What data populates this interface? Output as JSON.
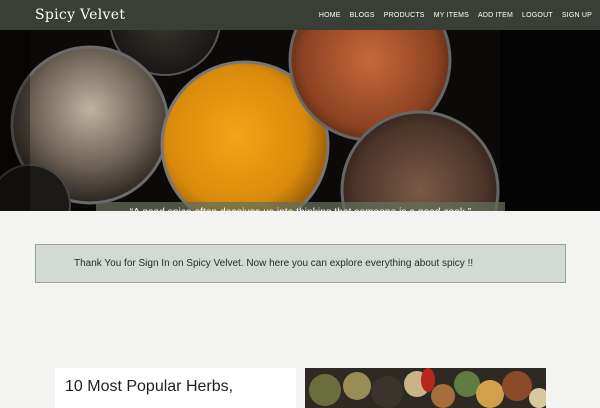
{
  "navbar": {
    "brand": "Spicy Velvet",
    "links": [
      "HOME",
      "BLOGS",
      "PRODUCTS",
      "MY ITEMS",
      "ADD ITEM",
      "LOGOUT",
      "SIGN UP"
    ]
  },
  "hero": {
    "quote": "“A good spice often deceives us into thinking that someone is a good cook.”",
    "slide_count": 6,
    "active_slide": 4
  },
  "alert": {
    "message": "Thank You for Sign In on Spicy Velvet. Now here you can explore everything about spicy !!"
  },
  "blog": {
    "title": "10 Most Popular Herbs,"
  },
  "colors": {
    "navbar": "#3a3f36",
    "alert_bg": "#d3dad3",
    "page_bg": "#f3f3f1"
  }
}
